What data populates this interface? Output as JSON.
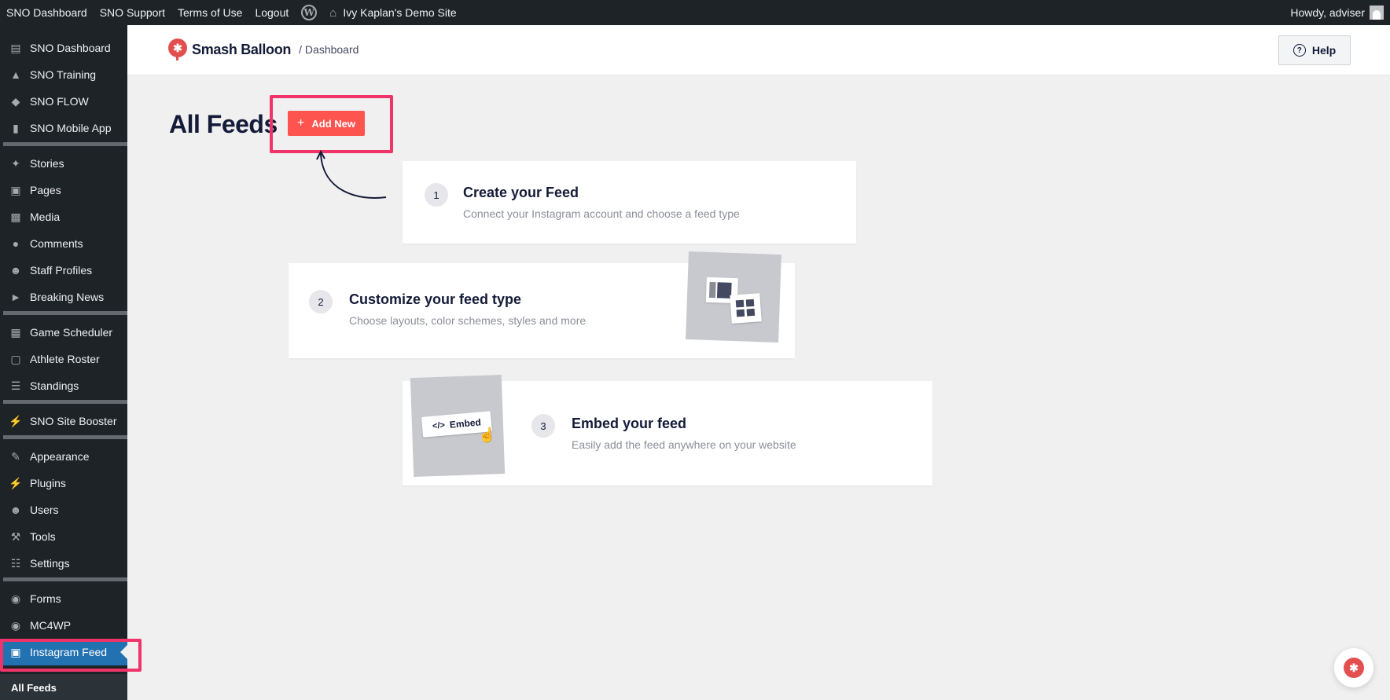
{
  "adminbar": {
    "items": [
      "SNO Dashboard",
      "SNO Support",
      "Terms of Use",
      "Logout"
    ],
    "wp_logo_icon": "wordpress-icon",
    "site_name": "Ivy Kaplan's Demo Site",
    "howdy": "Howdy, adviser"
  },
  "sidebar": {
    "items": [
      {
        "label": "SNO Dashboard",
        "icon": "dashboard-icon"
      },
      {
        "label": "SNO Training",
        "icon": "graduation-cap-icon"
      },
      {
        "label": "SNO FLOW",
        "icon": "shield-icon"
      },
      {
        "label": "SNO Mobile App",
        "icon": "phone-icon"
      },
      {
        "label": "Stories",
        "icon": "pushpin-icon"
      },
      {
        "label": "Pages",
        "icon": "pages-icon"
      },
      {
        "label": "Media",
        "icon": "media-icon"
      },
      {
        "label": "Comments",
        "icon": "comment-icon"
      },
      {
        "label": "Staff Profiles",
        "icon": "person-icon"
      },
      {
        "label": "Breaking News",
        "icon": "megaphone-icon"
      },
      {
        "label": "Game Scheduler",
        "icon": "calendar-icon"
      },
      {
        "label": "Athlete Roster",
        "icon": "id-card-icon"
      },
      {
        "label": "Standings",
        "icon": "list-icon"
      },
      {
        "label": "SNO Site Booster",
        "icon": "plugin-icon"
      },
      {
        "label": "Appearance",
        "icon": "brush-icon"
      },
      {
        "label": "Plugins",
        "icon": "plugin-icon"
      },
      {
        "label": "Users",
        "icon": "person-icon"
      },
      {
        "label": "Tools",
        "icon": "wrench-icon"
      },
      {
        "label": "Settings",
        "icon": "sliders-icon"
      },
      {
        "label": "Forms",
        "icon": "forms-icon"
      },
      {
        "label": "MC4WP",
        "icon": "mc4wp-icon"
      },
      {
        "label": "Instagram Feed",
        "icon": "camera-icon"
      }
    ],
    "submenu": {
      "current": "All Feeds"
    }
  },
  "header": {
    "brand": "Smash Balloon",
    "breadcrumb": "/ Dashboard",
    "help": "Help"
  },
  "main": {
    "title": "All Feeds",
    "add_new": "Add New",
    "steps": [
      {
        "num": "1",
        "title": "Create your Feed",
        "desc": "Connect your Instagram account and choose a feed type"
      },
      {
        "num": "2",
        "title": "Customize your feed type",
        "desc": "Choose layouts, color schemes, styles and more"
      },
      {
        "num": "3",
        "title": "Embed your feed",
        "desc": "Easily add the feed anywhere on your website"
      }
    ],
    "embed_tag": "Embed"
  },
  "colors": {
    "accent": "#fe544f",
    "highlight": "#f0346a",
    "sidebar_bg": "#1d2327",
    "current_menu": "#2271b1"
  }
}
